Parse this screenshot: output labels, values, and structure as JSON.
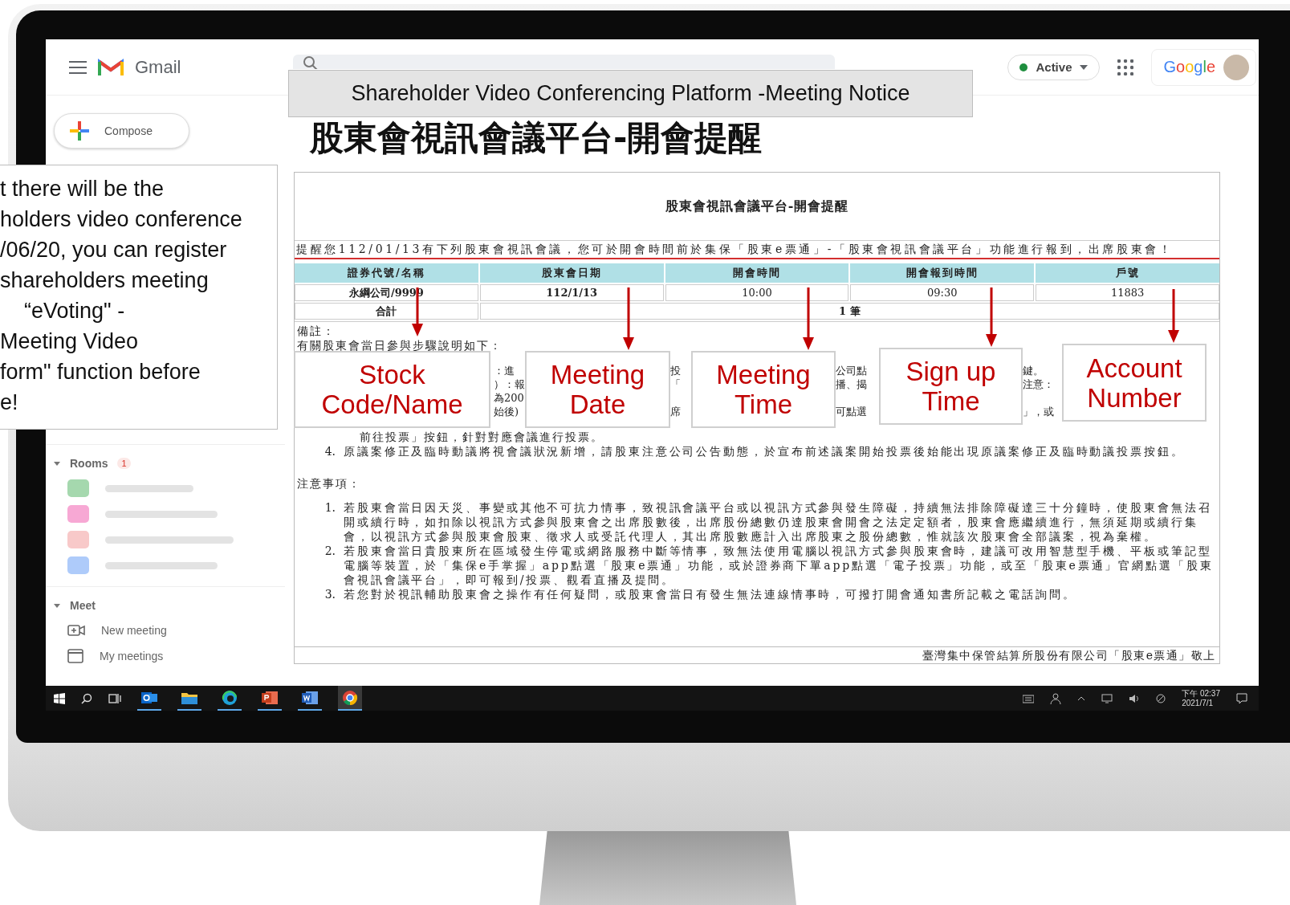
{
  "gmail": {
    "app_name": "Gmail",
    "compose": "Compose",
    "status": {
      "label": "Active",
      "online": true
    },
    "brand": "Google",
    "rooms_label": "Rooms",
    "rooms_badge": "1",
    "rooms": [
      {
        "color": "#a5d8ae"
      },
      {
        "color": "#f7a8d4"
      },
      {
        "color": "#f8c9c9"
      },
      {
        "color": "#aecbfa"
      }
    ],
    "meet_label": "Meet",
    "meet_items": [
      {
        "kind": "video",
        "label": "New meeting"
      },
      {
        "kind": "calendar",
        "label": "My meetings"
      }
    ]
  },
  "banner": "Shareholder Video Conferencing Platform -Meeting Notice",
  "page_title": "股東會視訊會議平台-開會提醒",
  "notice": {
    "heading": "股東會視訊會議平台-開會提醒",
    "reminder": "提醒您112/01/13有下列股東會視訊會議，您可於開會時間前於集保「股東e票通」-「股東會視訊會議平台」功能進行報到，出席股東會！",
    "table": {
      "columns": [
        "證券代號/名稱",
        "股東會日期",
        "開會時間",
        "開會報到時間",
        "戶號"
      ],
      "rows": [
        [
          "永綱公司/9999",
          "112/1/13",
          "10:00",
          "09:30",
          "11883"
        ]
      ],
      "total_label": "合計",
      "total_value": "1 筆"
    },
    "remarks_label": "備註：",
    "steps_intro": "有關股東會當日參與步驟說明如下：",
    "step_fragments": [
      {
        "upper": [
          "：進",
          "）：報",
          "為200",
          "始後)"
        ]
      },
      {
        "upper": [
          "投",
          "「"
        ],
        "lower": [
          "席"
        ]
      },
      {
        "upper": [
          "公司點",
          "播、揭"
        ],
        "lower": [
          "可點選"
        ]
      },
      {
        "upper": [
          "鍵。",
          "注意："
        ],
        "lower": [
          "」，或"
        ]
      }
    ],
    "step_continuation": "前往投票」按鈕，針對對應會議進行投票。",
    "steps": [
      {
        "number": "4.",
        "text": "原議案修正及臨時動議將視會議狀況新增，請股東注意公司公告動態，於宣布前述議案開始投票後始能出現原議案修正及臨時動議投票按鈕。"
      }
    ],
    "cautions_label": "注意事項：",
    "cautions": [
      {
        "number": "1.",
        "text": "若股東會當日因天災、事變或其他不可抗力情事，致視訊會議平台或以視訊方式參與發生障礙，持續無法排除障礙達三十分鐘時，使股東會無法召開或續行時，如扣除以視訊方式參與股東會之出席股數後，出席股份總數仍達股東會開會之法定定額者，股東會應繼續進行，無須延期或續行集會，以視訊方式參與股東會股東、徵求人或受託代理人，其出席股數應計入出席股東之股份總數，惟就該次股東會全部議案，視為棄權。"
      },
      {
        "number": "2.",
        "text": "若股東會當日貴股東所在區域發生停電或網路服務中斷等情事，致無法使用電腦以視訊方式參與股東會時，建議可改用智慧型手機、平板或筆記型電腦等裝置，於「集保e手掌握」app點選「股東e票通」功能，或於證券商下單app點選「電子投票」功能，或至「股東e票通」官網點選「股東會視訊會議平台」，即可報到/投票、觀看直播及提問。"
      },
      {
        "number": "3.",
        "text": "若您對於視訊輔助股東會之操作有任何疑問，或股東會當日有發生無法連線情事時，可撥打開會通知書所記載之電話詢問。"
      }
    ],
    "signature": "臺灣集中保管結算所股份有限公司「股東e票通」敬上"
  },
  "left_callout": {
    "lines": [
      "t there will be the",
      "holders video conference",
      "/06/20, you can register",
      "shareholders meeting",
      "    “eVoting\" -",
      "Meeting Video",
      "form\" function before",
      "e!"
    ]
  },
  "callouts": [
    {
      "text": "Stock Code/Name"
    },
    {
      "text": "Meeting Date"
    },
    {
      "text": "Meeting Time"
    },
    {
      "text": "Sign up Time"
    },
    {
      "text": "Account Number"
    }
  ],
  "taskbar": {
    "time": "下午 02:37",
    "date": "2021/7/1"
  }
}
